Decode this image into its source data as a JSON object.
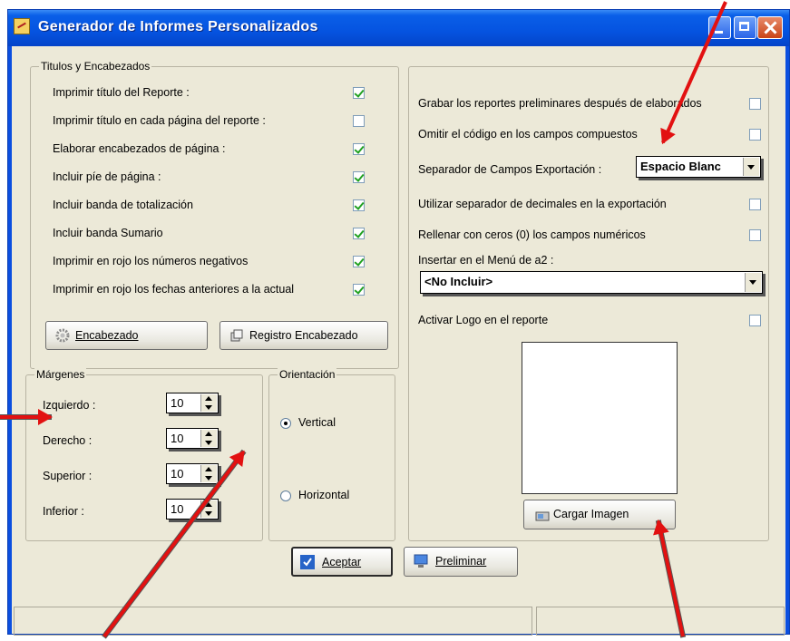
{
  "window": {
    "title": "Generador de Informes Personalizados"
  },
  "titulos": {
    "legend": "Titulos y Encabezados",
    "items": [
      {
        "label": "Imprimir título del Reporte :",
        "checked": true
      },
      {
        "label": "Imprimir título en cada página del reporte :",
        "checked": false
      },
      {
        "label": "Elaborar encabezados de página :",
        "checked": true
      },
      {
        "label": "Incluir píe de página :",
        "checked": true
      },
      {
        "label": "Incluir banda de totalización",
        "checked": true
      },
      {
        "label": "Incluir banda Sumario",
        "checked": true
      },
      {
        "label": "Imprimir en rojo los números negativos",
        "checked": true
      },
      {
        "label": "Imprimir en rojo los fechas anteriores a la actual",
        "checked": true
      }
    ],
    "encabezado_button": "Encabezado",
    "registro_button": "Registro Encabezado"
  },
  "margenes": {
    "legend": "Márgenes",
    "items": [
      {
        "label": "Izquierdo :",
        "value": "10"
      },
      {
        "label": "Derecho :",
        "value": "10"
      },
      {
        "label": "Superior :",
        "value": "10"
      },
      {
        "label": "Inferior :",
        "value": "10"
      }
    ]
  },
  "orientacion": {
    "legend": "Orientación",
    "vertical": "Vertical",
    "horizontal": "Horizontal",
    "selected": "Vertical"
  },
  "opciones": {
    "grabar": {
      "label": "Grabar los reportes preliminares después de elaborados",
      "checked": false
    },
    "omitir": {
      "label": "Omitir el código en los campos compuestos",
      "checked": false
    },
    "separador_label": "Separador de Campos Exportación :",
    "separador_value": "Espacio Blanc",
    "decimales": {
      "label": "Utilizar separador de decimales en la exportación",
      "checked": false
    },
    "rellenar": {
      "label": "Rellenar con ceros (0) los campos numéricos",
      "checked": false
    },
    "menu_label": "Insertar en  el Menú de a2 :",
    "menu_value": "<No Incluir>",
    "logo": {
      "label": "Activar Logo en el reporte",
      "checked": false
    },
    "cargar_button": "Cargar Imagen"
  },
  "footer": {
    "aceptar_button": "Aceptar",
    "preliminar_button": "Preliminar"
  },
  "colors": {
    "title_bar": "#0553e0",
    "annotation_arrow": "#e21111",
    "window_bg": "#ece9d8"
  }
}
